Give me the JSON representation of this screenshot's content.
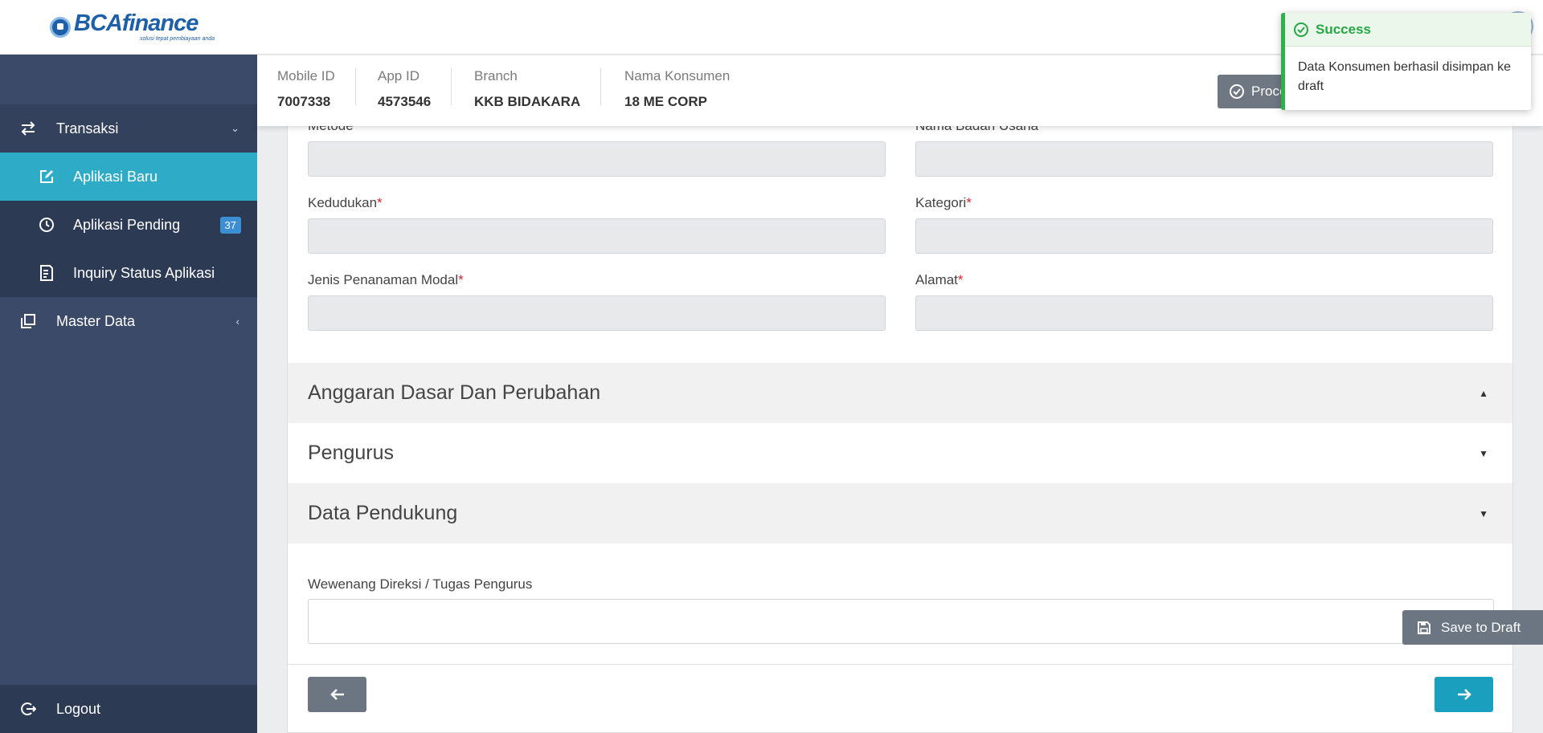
{
  "brand": {
    "name": "BCAfinance",
    "tagline": "solusi tepat pembiayaan anda"
  },
  "sidebar": {
    "groups": [
      {
        "label": "Transaksi",
        "icon": "swap-arrows-icon",
        "expanded": true
      },
      {
        "label": "Master Data",
        "icon": "stack-pages-icon",
        "expanded": false
      }
    ],
    "items": [
      {
        "label": "Aplikasi Baru",
        "icon": "edit-square-icon",
        "active": true
      },
      {
        "label": "Aplikasi Pending",
        "icon": "clock-icon",
        "badge": "37"
      },
      {
        "label": "Inquiry Status Aplikasi",
        "icon": "document-list-icon"
      }
    ],
    "logout_label": "Logout"
  },
  "info": {
    "mobile_id": {
      "label": "Mobile ID",
      "value": "7007338"
    },
    "app_id": {
      "label": "App ID",
      "value": "4573546"
    },
    "branch": {
      "label": "Branch",
      "value": "KKB BIDAKARA"
    },
    "nama_konsumen": {
      "label": "Nama Konsumen",
      "value": "18 ME CORP"
    },
    "process_label": "Proce"
  },
  "form": {
    "metode_label": "Metode",
    "nama_badan_usaha_label": "Nama Badan Usaha",
    "kedudukan_label": "Kedudukan",
    "kategori_label": "Kategori",
    "jenis_penanaman_modal_label": "Jenis Penanaman Modal",
    "alamat_label": "Alamat",
    "required_mark": "*",
    "wewenang_label": "Wewenang Direksi / Tugas Pengurus"
  },
  "sections": [
    {
      "title": "Anggaran Dasar Dan Perubahan",
      "expanded": true
    },
    {
      "title": "Pengurus",
      "expanded": false
    },
    {
      "title": "Data Pendukung",
      "expanded": false
    }
  ],
  "save_draft_label": "Save to Draft",
  "toast": {
    "title": "Success",
    "message": "Data Konsumen berhasil disimpan ke draft",
    "color": "#2bb34a"
  },
  "colors": {
    "sidebar": "#3b4a69",
    "active": "#2eabc6",
    "next": "#1aa0be"
  }
}
